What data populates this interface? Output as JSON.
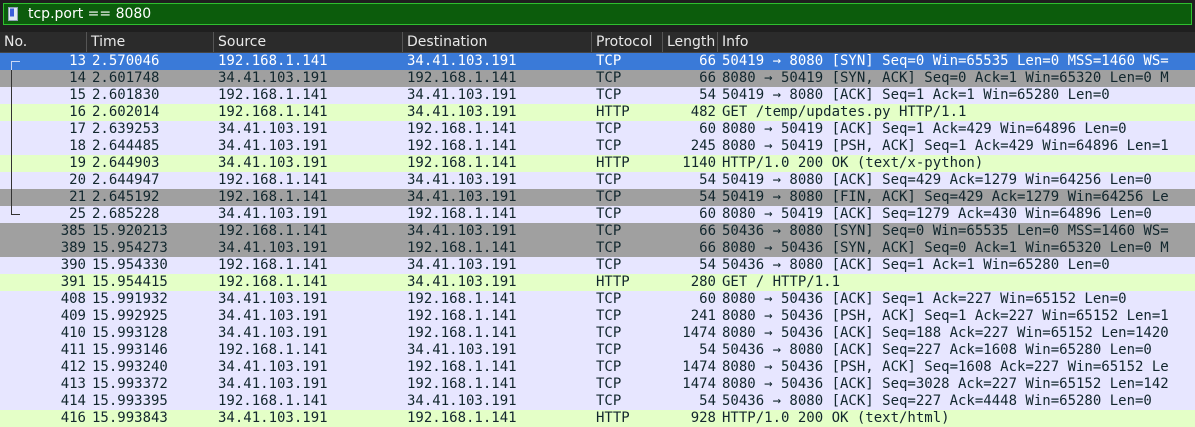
{
  "filter": {
    "text": "tcp.port == 8080"
  },
  "columns": [
    "No.",
    "Time",
    "Source",
    "Destination",
    "Protocol",
    "Length",
    "Info"
  ],
  "colors": {
    "tcp": "#e7e6ff",
    "http": "#e4ffc7",
    "gray": "#a0a0a0",
    "selected": "#3a7ad8",
    "selected_text": "#ffffff",
    "text": "#12272e"
  },
  "rows": [
    {
      "no": "13",
      "time": "2.570046",
      "src": "192.168.1.141",
      "dst": "34.41.103.191",
      "proto": "TCP",
      "len": "66",
      "info": "50419 → 8080 [SYN] Seq=0 Win=65535 Len=0 MSS=1460 WS=",
      "style": "selected",
      "tree": "start"
    },
    {
      "no": "14",
      "time": "2.601748",
      "src": "34.41.103.191",
      "dst": "192.168.1.141",
      "proto": "TCP",
      "len": "66",
      "info": "8080 → 50419 [SYN, ACK] Seq=0 Ack=1 Win=65320 Len=0 M",
      "style": "gray",
      "tree": "mid"
    },
    {
      "no": "15",
      "time": "2.601830",
      "src": "192.168.1.141",
      "dst": "34.41.103.191",
      "proto": "TCP",
      "len": "54",
      "info": "50419 → 8080 [ACK] Seq=1 Ack=1 Win=65280 Len=0",
      "style": "tcp",
      "tree": "mid"
    },
    {
      "no": "16",
      "time": "2.602014",
      "src": "192.168.1.141",
      "dst": "34.41.103.191",
      "proto": "HTTP",
      "len": "482",
      "info": "GET /temp/updates.py HTTP/1.1",
      "style": "http",
      "tree": "mid"
    },
    {
      "no": "17",
      "time": "2.639253",
      "src": "34.41.103.191",
      "dst": "192.168.1.141",
      "proto": "TCP",
      "len": "60",
      "info": "8080 → 50419 [ACK] Seq=1 Ack=429 Win=64896 Len=0",
      "style": "tcp",
      "tree": "mid"
    },
    {
      "no": "18",
      "time": "2.644485",
      "src": "34.41.103.191",
      "dst": "192.168.1.141",
      "proto": "TCP",
      "len": "245",
      "info": "8080 → 50419 [PSH, ACK] Seq=1 Ack=429 Win=64896 Len=1",
      "style": "tcp",
      "tree": "mid"
    },
    {
      "no": "19",
      "time": "2.644903",
      "src": "34.41.103.191",
      "dst": "192.168.1.141",
      "proto": "HTTP",
      "len": "1140",
      "info": "HTTP/1.0 200 OK  (text/x-python)",
      "style": "http",
      "tree": "mid"
    },
    {
      "no": "20",
      "time": "2.644947",
      "src": "192.168.1.141",
      "dst": "34.41.103.191",
      "proto": "TCP",
      "len": "54",
      "info": "50419 → 8080 [ACK] Seq=429 Ack=1279 Win=64256 Len=0",
      "style": "tcp",
      "tree": "mid"
    },
    {
      "no": "21",
      "time": "2.645192",
      "src": "192.168.1.141",
      "dst": "34.41.103.191",
      "proto": "TCP",
      "len": "54",
      "info": "50419 → 8080 [FIN, ACK] Seq=429 Ack=1279 Win=64256 Le",
      "style": "gray",
      "tree": "mid"
    },
    {
      "no": "25",
      "time": "2.685228",
      "src": "34.41.103.191",
      "dst": "192.168.1.141",
      "proto": "TCP",
      "len": "60",
      "info": "8080 → 50419 [ACK] Seq=1279 Ack=430 Win=64896 Len=0",
      "style": "tcp",
      "tree": "end"
    },
    {
      "no": "385",
      "time": "15.920213",
      "src": "192.168.1.141",
      "dst": "34.41.103.191",
      "proto": "TCP",
      "len": "66",
      "info": "50436 → 8080 [SYN] Seq=0 Win=65535 Len=0 MSS=1460 WS=",
      "style": "gray",
      "tree": ""
    },
    {
      "no": "389",
      "time": "15.954273",
      "src": "34.41.103.191",
      "dst": "192.168.1.141",
      "proto": "TCP",
      "len": "66",
      "info": "8080 → 50436 [SYN, ACK] Seq=0 Ack=1 Win=65320 Len=0 M",
      "style": "gray",
      "tree": ""
    },
    {
      "no": "390",
      "time": "15.954330",
      "src": "192.168.1.141",
      "dst": "34.41.103.191",
      "proto": "TCP",
      "len": "54",
      "info": "50436 → 8080 [ACK] Seq=1 Ack=1 Win=65280 Len=0",
      "style": "tcp",
      "tree": ""
    },
    {
      "no": "391",
      "time": "15.954415",
      "src": "192.168.1.141",
      "dst": "34.41.103.191",
      "proto": "HTTP",
      "len": "280",
      "info": "GET / HTTP/1.1",
      "style": "http",
      "tree": ""
    },
    {
      "no": "408",
      "time": "15.991932",
      "src": "34.41.103.191",
      "dst": "192.168.1.141",
      "proto": "TCP",
      "len": "60",
      "info": "8080 → 50436 [ACK] Seq=1 Ack=227 Win=65152 Len=0",
      "style": "tcp",
      "tree": ""
    },
    {
      "no": "409",
      "time": "15.992925",
      "src": "34.41.103.191",
      "dst": "192.168.1.141",
      "proto": "TCP",
      "len": "241",
      "info": "8080 → 50436 [PSH, ACK] Seq=1 Ack=227 Win=65152 Len=1",
      "style": "tcp",
      "tree": ""
    },
    {
      "no": "410",
      "time": "15.993128",
      "src": "34.41.103.191",
      "dst": "192.168.1.141",
      "proto": "TCP",
      "len": "1474",
      "info": "8080 → 50436 [ACK] Seq=188 Ack=227 Win=65152 Len=1420",
      "style": "tcp",
      "tree": ""
    },
    {
      "no": "411",
      "time": "15.993146",
      "src": "192.168.1.141",
      "dst": "34.41.103.191",
      "proto": "TCP",
      "len": "54",
      "info": "50436 → 8080 [ACK] Seq=227 Ack=1608 Win=65280 Len=0",
      "style": "tcp",
      "tree": ""
    },
    {
      "no": "412",
      "time": "15.993240",
      "src": "34.41.103.191",
      "dst": "192.168.1.141",
      "proto": "TCP",
      "len": "1474",
      "info": "8080 → 50436 [PSH, ACK] Seq=1608 Ack=227 Win=65152 Le",
      "style": "tcp",
      "tree": ""
    },
    {
      "no": "413",
      "time": "15.993372",
      "src": "34.41.103.191",
      "dst": "192.168.1.141",
      "proto": "TCP",
      "len": "1474",
      "info": "8080 → 50436 [ACK] Seq=3028 Ack=227 Win=65152 Len=142",
      "style": "tcp",
      "tree": ""
    },
    {
      "no": "414",
      "time": "15.993395",
      "src": "192.168.1.141",
      "dst": "34.41.103.191",
      "proto": "TCP",
      "len": "54",
      "info": "50436 → 8080 [ACK] Seq=227 Ack=4448 Win=65280 Len=0",
      "style": "tcp",
      "tree": ""
    },
    {
      "no": "416",
      "time": "15.993843",
      "src": "34.41.103.191",
      "dst": "192.168.1.141",
      "proto": "HTTP",
      "len": "928",
      "info": "HTTP/1.0 200 OK  (text/html)",
      "style": "http",
      "tree": ""
    }
  ]
}
